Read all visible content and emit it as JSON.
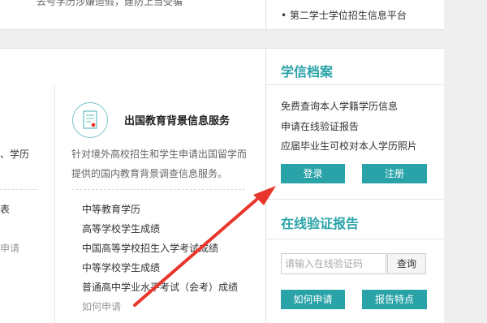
{
  "top": {
    "left_text": "去号学历涉嫌造假，建防上当受骗",
    "right_text": "• 第二学士学位招生信息平台"
  },
  "left_fragments": {
    "frag1": "、学历",
    "frag2": "表",
    "frag3": "申请"
  },
  "service": {
    "icon": "certificate-icon",
    "title": "出国教育背景信息服务",
    "desc_line1": "针对境外高校招生和学生申请出国留学而",
    "desc_line2": "提供的国内教育背景调查信息服务。",
    "items": [
      "中等教育学历",
      "高等学校学生成绩",
      "中国高等学校招生入学考试成绩",
      "中等学校学生成绩",
      "普通高中学业水平考试（会考）成绩"
    ],
    "how_to_apply": "如何申请"
  },
  "archive": {
    "title": "学信档案",
    "links": [
      "免费查询本人学籍学历信息",
      "申请在线验证报告",
      "应届毕业生可校对本人学历照片"
    ],
    "login": "登录",
    "register": "注册"
  },
  "verify": {
    "title": "在线验证报告",
    "placeholder": "请输入在线验证码",
    "query": "查询",
    "how_to_apply": "如何申请",
    "features": "报告特点"
  },
  "colors": {
    "accent": "#2aa3a8",
    "arrow": "#e8362c"
  }
}
